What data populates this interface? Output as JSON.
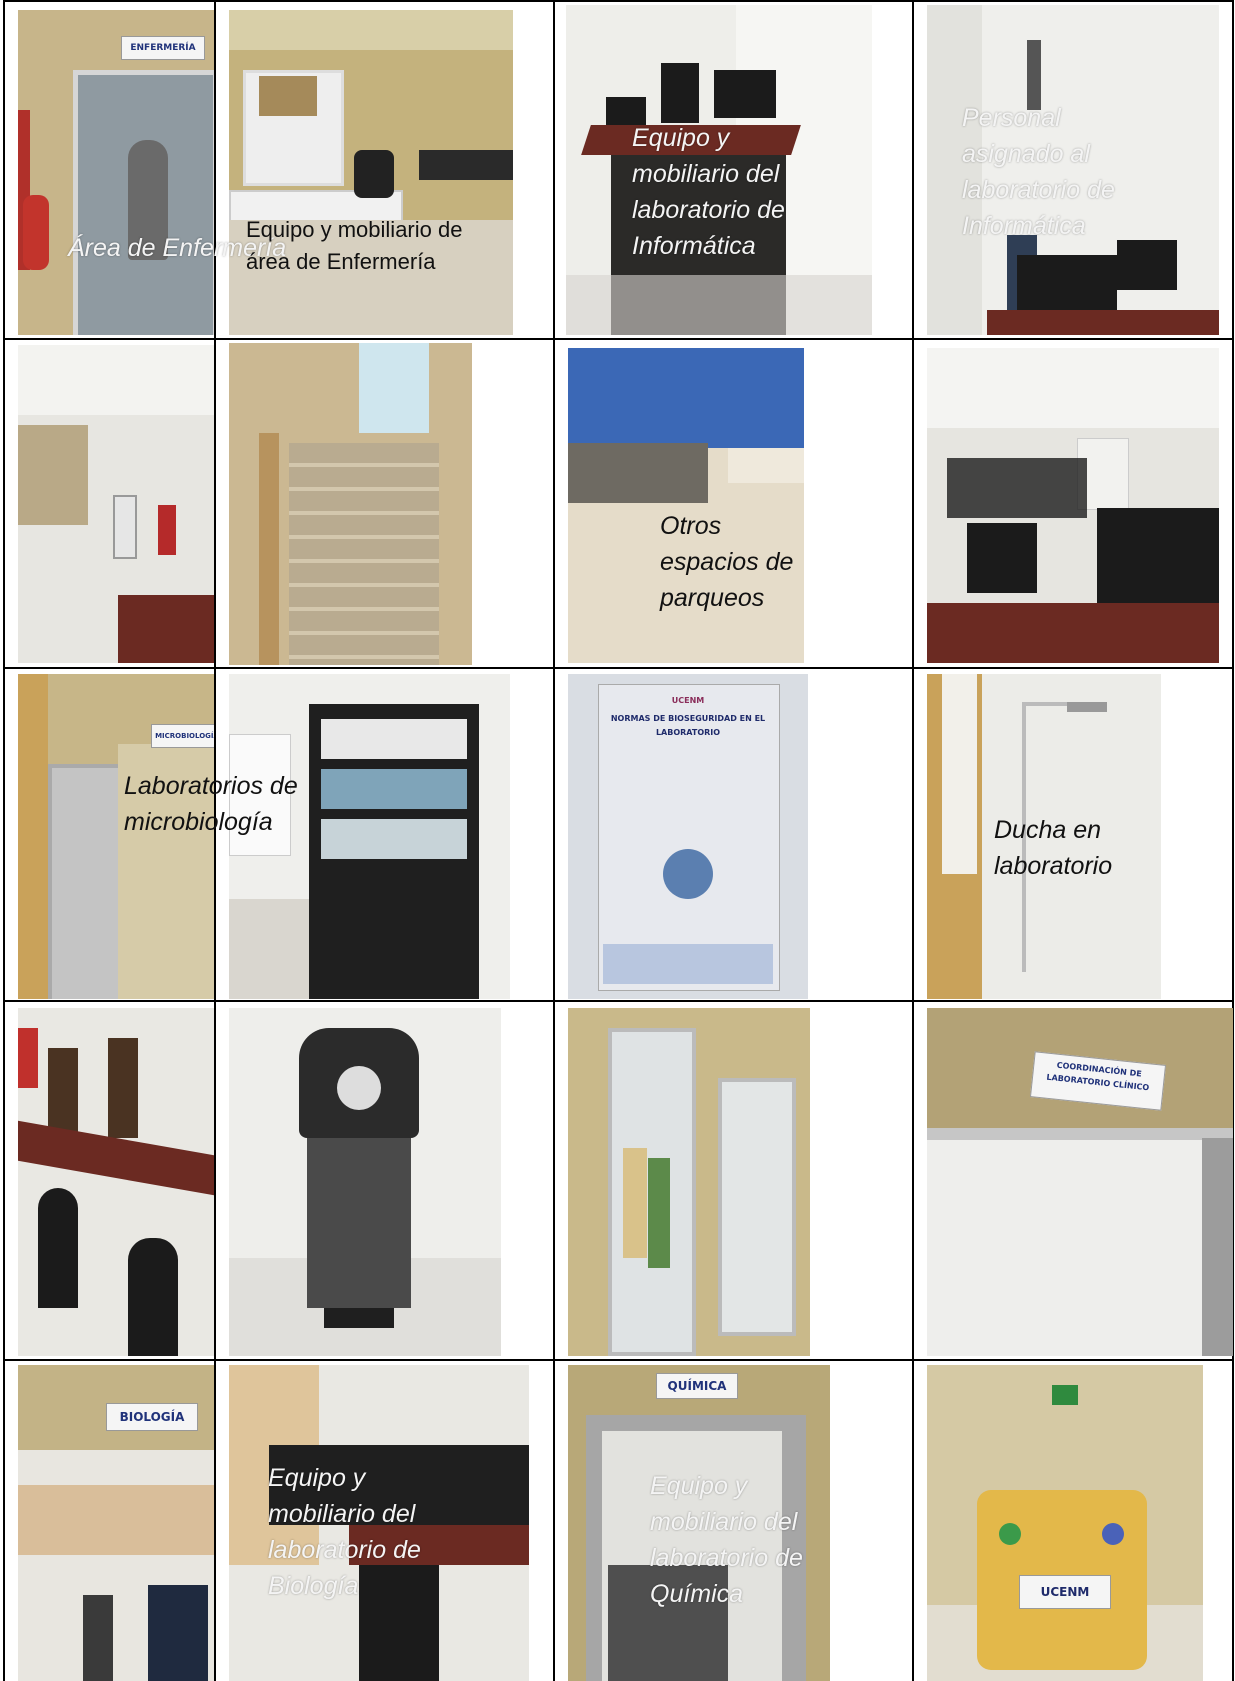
{
  "page": {
    "row1": {
      "captions": {
        "nursing_area": "Área de Enfermería",
        "nursing_equipment": "Equipo y mobiliario de área de Enfermería",
        "computer_lab_equipment": "Equipo y mobiliario del laboratorio de Informática",
        "computer_lab_staff": "Personal asignado al laboratorio de Informática"
      },
      "sign_nursing": "ENFERMERÍA"
    },
    "row2": {
      "captions": {
        "parking": "Otros espacios de parqueos"
      }
    },
    "row3": {
      "captions": {
        "microbiology_labs": "Laboratorios de microbiología",
        "lab_shower": "Ducha en laboratorio"
      },
      "sign_microbiology": "MICROBIOLOGÍA",
      "poster_title": "NORMAS DE BIOSEGURIDAD EN EL LABORATORIO",
      "poster_logo": "UCENM"
    },
    "row4": {
      "sign_coordination": "COORDINACIÓN DE LABORATORIO CLÍNICO"
    },
    "row5": {
      "captions": {
        "biology_lab_equipment": "Equipo y mobiliario del laboratorio de Biología",
        "chemistry_lab_equipment": "Equipo y mobiliario del laboratorio de Química"
      },
      "sign_biology": "BIOLOGÍA",
      "sign_chemistry": "QUÍMICA",
      "bin_logo": "UCENM"
    }
  },
  "colors": {
    "wall_beige": "#c9b98a",
    "furniture_red": "#6b2a22",
    "monitor_black": "#1b1b1b",
    "floor": "#e3e1dc"
  }
}
